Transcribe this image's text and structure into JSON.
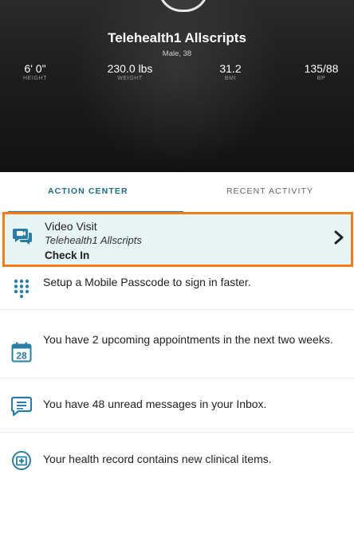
{
  "colors": {
    "accent": "#2a7ea6",
    "highlight_border": "#f07d1a",
    "alert_background": "#e6f4f6",
    "header_background": "#1c1c1c"
  },
  "patient": {
    "name": "Telehealth1 Allscripts",
    "demographics": "Male, 38"
  },
  "vitals": [
    {
      "value": "6' 0\"",
      "label": "HEIGHT"
    },
    {
      "value": "230.0 lbs",
      "label": "WEIGHT"
    },
    {
      "value": "31.2",
      "label": "BMI"
    },
    {
      "value": "135/88",
      "label": "BP"
    }
  ],
  "tabs": {
    "action_center": "ACTION CENTER",
    "recent_activity": "RECENT ACTIVITY",
    "selected": "action_center"
  },
  "alert": {
    "icon": "video-chat-icon",
    "title": "Video Visit",
    "subtitle": "Telehealth1 Allscripts",
    "action": "Check In"
  },
  "action_items": [
    {
      "icon": "keypad-icon",
      "text": "Setup a Mobile Passcode to sign in faster."
    },
    {
      "icon": "calendar-icon",
      "calendar_day": "28",
      "text": "You have 2 upcoming appointments in the next two weeks."
    },
    {
      "icon": "message-icon",
      "text": "You have 48 unread messages in your Inbox."
    },
    {
      "icon": "health-record-icon",
      "text": "Your health record contains new clinical items."
    }
  ]
}
